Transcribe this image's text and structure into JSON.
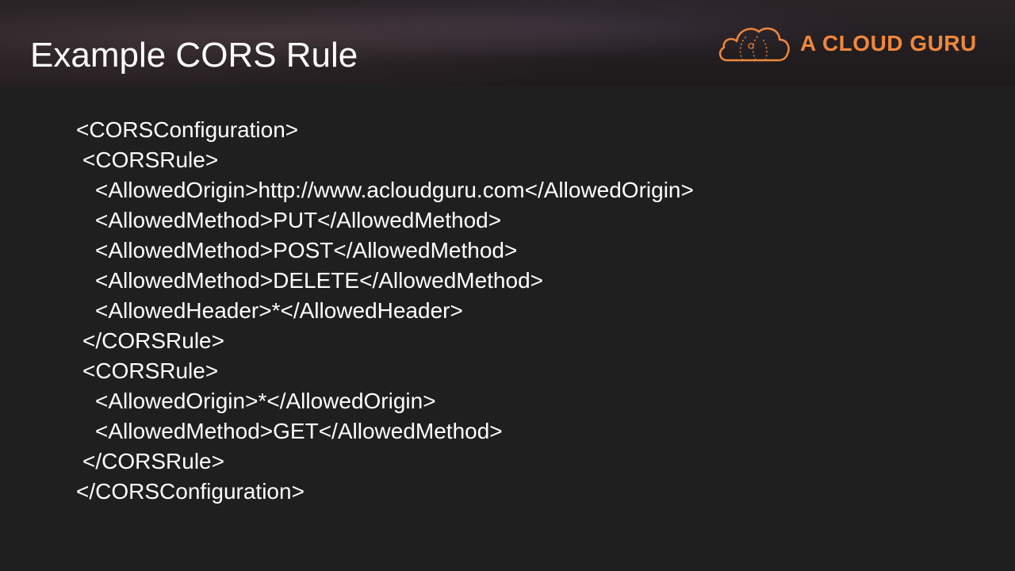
{
  "slide": {
    "title": "Example CORS Rule",
    "logo_text": "A CLOUD GURU",
    "logo_icon": "cloud-guru-icon",
    "accent_color": "#f1873c",
    "background_color": "#1f1f1f"
  },
  "code": {
    "lines": [
      {
        "text": "<CORSConfiguration>",
        "indent": 0
      },
      {
        "text": "<CORSRule>",
        "indent": 1
      },
      {
        "text": "<AllowedOrigin>http://www.acloudguru.com</AllowedOrigin>",
        "indent": 2
      },
      {
        "text": "<AllowedMethod>PUT</AllowedMethod>",
        "indent": 2
      },
      {
        "text": "<AllowedMethod>POST</AllowedMethod>",
        "indent": 2
      },
      {
        "text": "<AllowedMethod>DELETE</AllowedMethod>",
        "indent": 2
      },
      {
        "text": "<AllowedHeader>*</AllowedHeader>",
        "indent": 2
      },
      {
        "text": "</CORSRule>",
        "indent": 1
      },
      {
        "text": "<CORSRule>",
        "indent": 1
      },
      {
        "text": "<AllowedOrigin>*</AllowedOrigin>",
        "indent": 2
      },
      {
        "text": "<AllowedMethod>GET</AllowedMethod>",
        "indent": 2
      },
      {
        "text": "</CORSRule>",
        "indent": 1
      },
      {
        "text": "</CORSConfiguration>",
        "indent": 0
      }
    ]
  }
}
